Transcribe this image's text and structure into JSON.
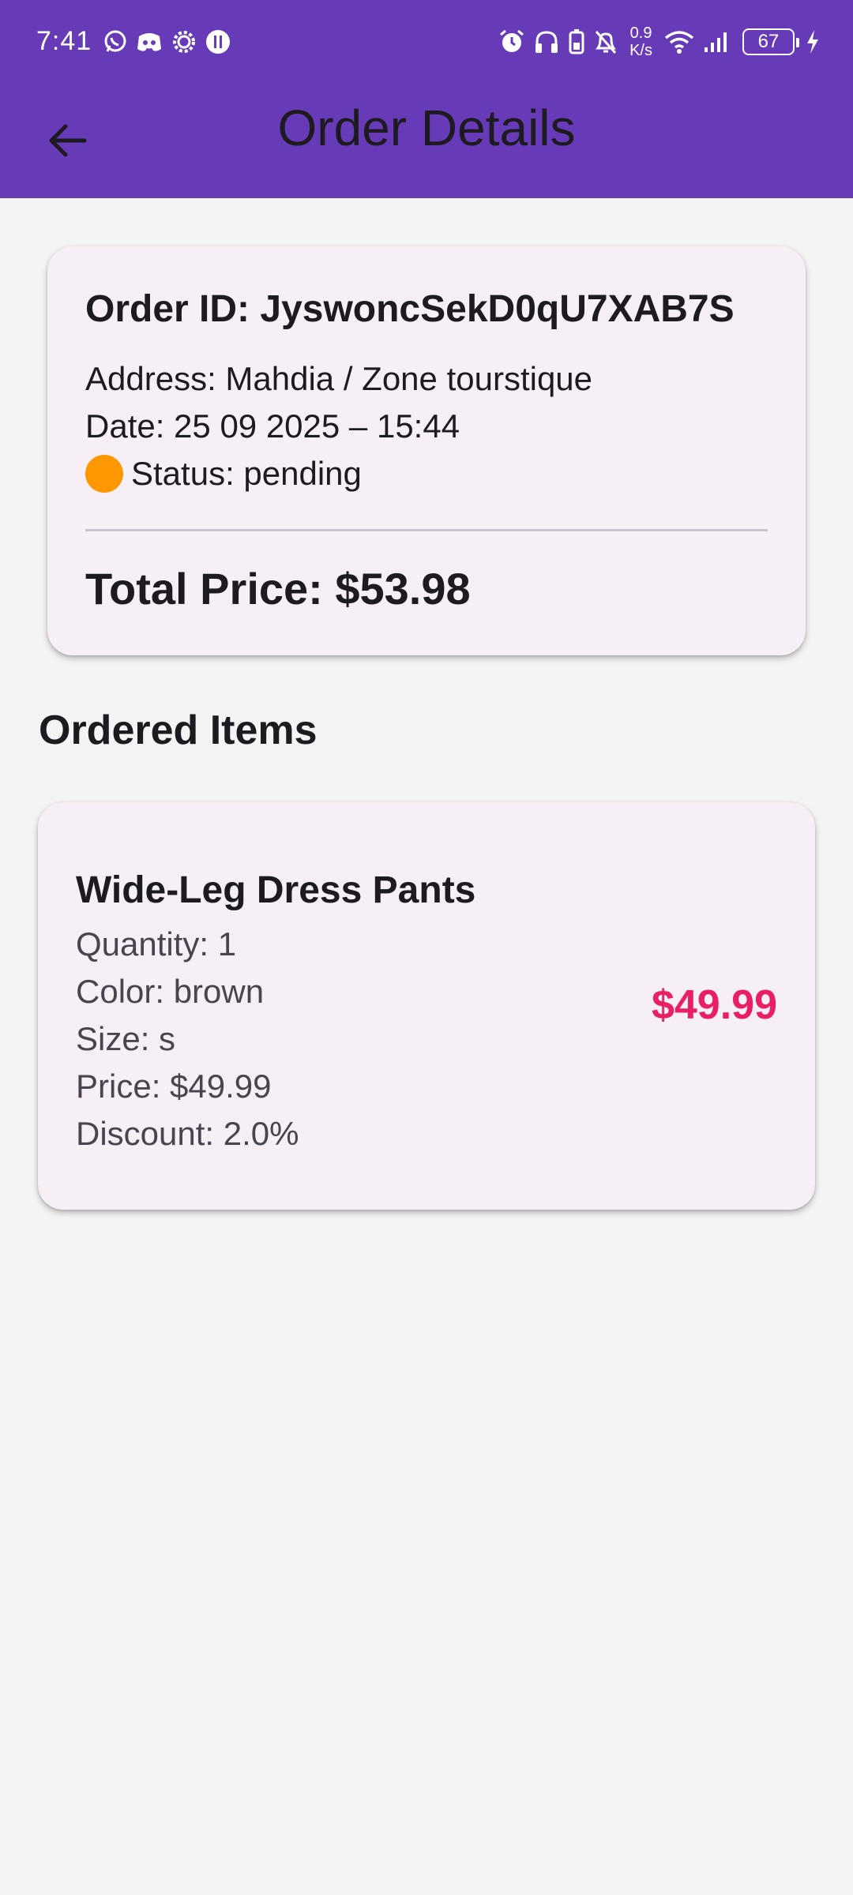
{
  "status_bar": {
    "time": "7:41",
    "net_speed_value": "0.9",
    "net_speed_unit": "K/s",
    "battery_level": "67",
    "left_icons": [
      "whatsapp-icon",
      "discord-icon",
      "settings-gear-icon",
      "app-notification-icon"
    ],
    "right_icons": [
      "alarm-icon",
      "headphones-icon",
      "battery-saver-icon",
      "mute-bell-icon",
      "wifi-icon",
      "cellular-signal-icon",
      "charging-bolt-icon"
    ]
  },
  "app_bar": {
    "title": "Order Details",
    "background_color": "#673ab7",
    "back_icon": "arrow-back-icon"
  },
  "order": {
    "id_text": "Order ID: JyswoncSekD0qU7XAB7S",
    "address_text": "Address: Mahdia / Zone tourstique",
    "date_text": "Date: 25 09 2025 – 15:44",
    "status_text": "Status: pending",
    "status_color": "#ff9800",
    "total_text": "Total Price: $53.98"
  },
  "ordered_items": {
    "section_title": "Ordered Items",
    "items": [
      {
        "name": "Wide-Leg Dress Pants",
        "quantity_text": "Quantity: 1",
        "color_text": "Color: brown",
        "size_text": "Size: s",
        "price_text": "Price: $49.99",
        "discount_text": "Discount: 2.0%",
        "price_badge": "$49.99",
        "price_color": "#e91e63"
      }
    ]
  }
}
